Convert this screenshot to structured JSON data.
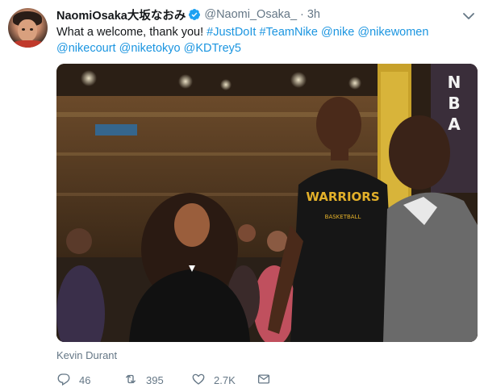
{
  "tweet": {
    "display_name": "NaomiOsaka大坂なおみ",
    "handle": "@Naomi_Osaka_",
    "separator": "·",
    "time": "3h",
    "text_parts": [
      {
        "text": "What a welcome, thank you! ",
        "link": false
      },
      {
        "text": "#JustDoIt",
        "link": true
      },
      {
        "text": " ",
        "link": false
      },
      {
        "text": "#TeamNike",
        "link": true
      },
      {
        "text": " ",
        "link": false
      },
      {
        "text": "@nike",
        "link": true
      },
      {
        "text": " ",
        "link": false
      },
      {
        "text": "@nikewomen",
        "link": true
      },
      {
        "text": " ",
        "link": false
      },
      {
        "text": "@nikecourt",
        "link": true
      },
      {
        "text": " ",
        "link": false
      },
      {
        "text": "@niketokyo",
        "link": true
      },
      {
        "text": " ",
        "link": false
      },
      {
        "text": "@KDTrey5",
        "link": true
      }
    ],
    "media": {
      "jersey_text": "WARRIORS",
      "jersey_subtext": "BASKETBALL",
      "banner_text": "NBA"
    },
    "media_caption": "Kevin Durant",
    "actions": {
      "replies": "46",
      "retweets": "395",
      "likes": "2.7K"
    }
  },
  "colors": {
    "link": "#1b95e0",
    "secondary_text": "#657786",
    "verified": "#1da1f2"
  },
  "icons": [
    "verified-badge-icon",
    "chevron-down-icon",
    "reply-icon",
    "retweet-icon",
    "like-icon",
    "direct-message-icon"
  ]
}
